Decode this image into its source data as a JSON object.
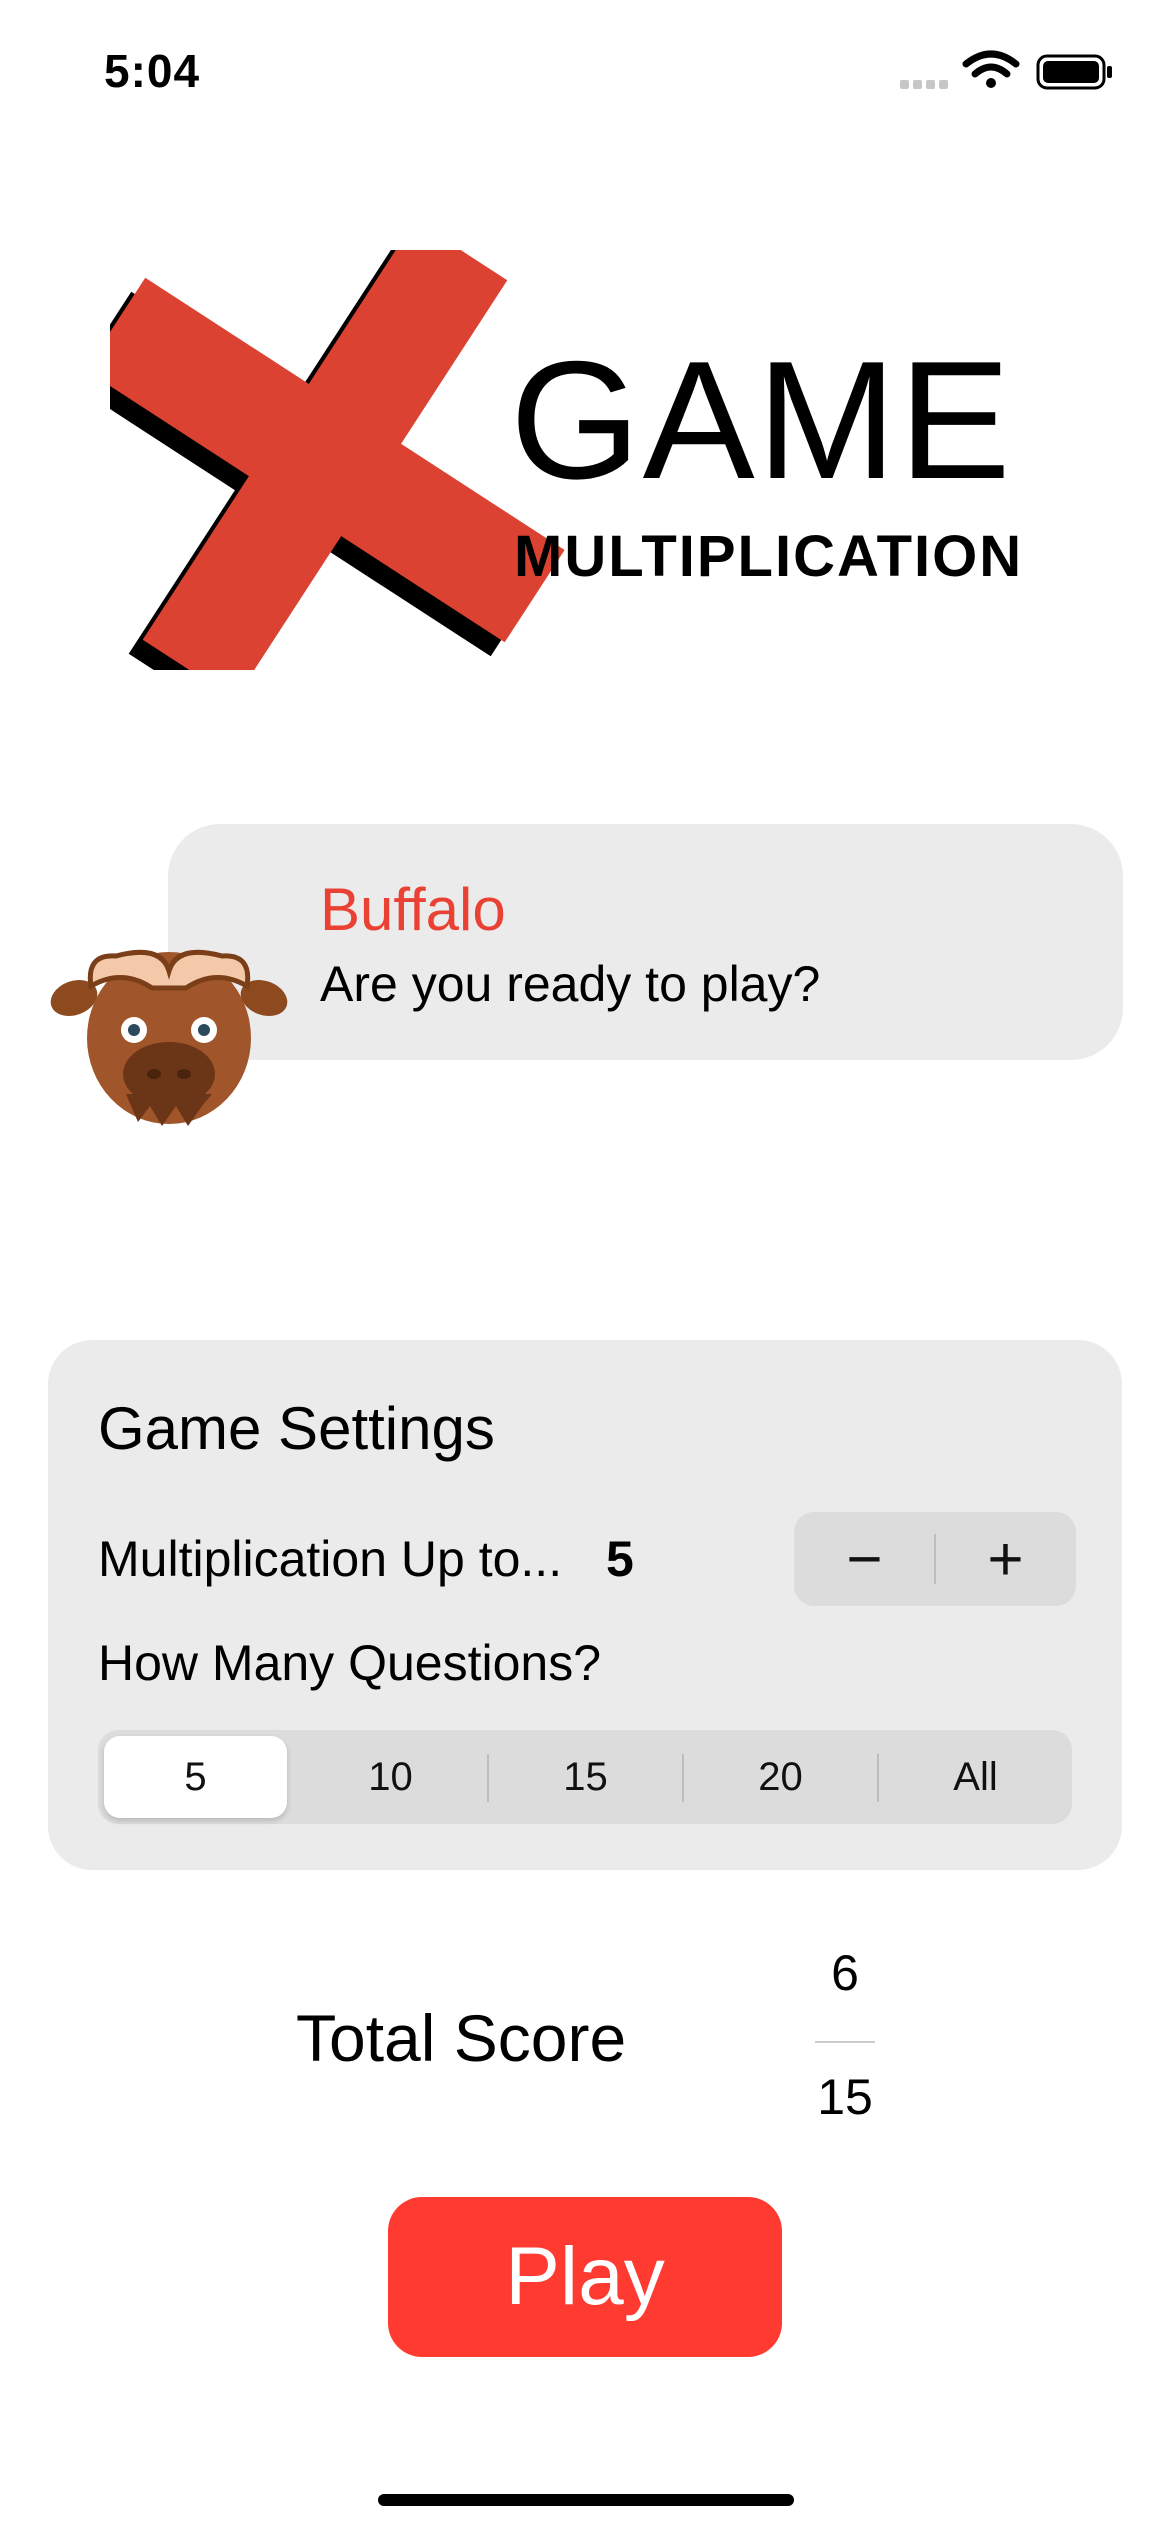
{
  "status_bar": {
    "time": "5:04"
  },
  "logo": {
    "title": "GAME",
    "subtitle": "MULTIPLICATION"
  },
  "character": {
    "name": "Buffalo",
    "message": "Are you ready to play?"
  },
  "settings": {
    "title": "Game Settings",
    "multiplication_label": "Multiplication Up to...",
    "multiplication_value": "5",
    "stepper": {
      "minus": "−",
      "plus": "+"
    },
    "questions_label": "How Many Questions?",
    "question_options": [
      "5",
      "10",
      "15",
      "20",
      "All"
    ],
    "selected_option": "5"
  },
  "score": {
    "label": "Total Score",
    "numerator": "6",
    "denominator": "15"
  },
  "play_button": {
    "label": "Play"
  },
  "colors": {
    "accent": "#ff3a30",
    "logo_red": "#dc4232",
    "name_red": "#e94235",
    "card_bg": "#ebebeb"
  }
}
